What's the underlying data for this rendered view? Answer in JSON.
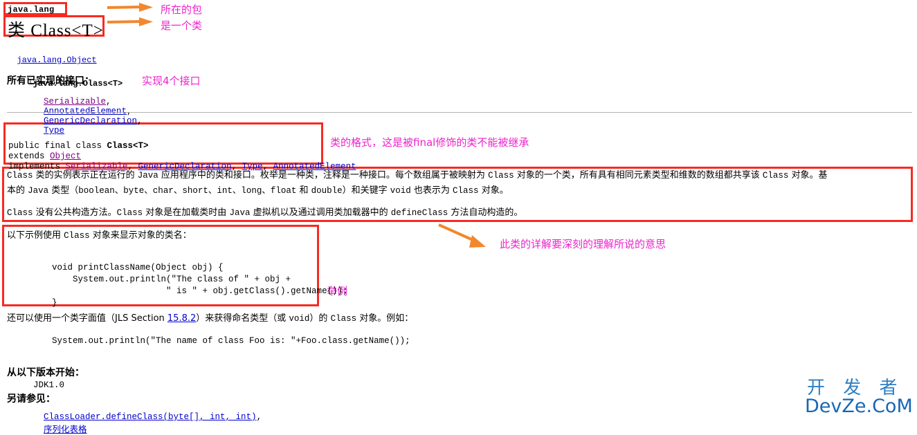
{
  "doc": {
    "package": "java.lang",
    "class_title": "类 Class<T>",
    "hierarchy": {
      "root": "java.lang.Object",
      "branch_glyph": "└",
      "child": "java.lang.Class<T>"
    },
    "interfaces_heading": "所有已实现的接口：",
    "interfaces": [
      "Serializable",
      "AnnotatedElement",
      "GenericDeclaration",
      "Type"
    ],
    "declaration": {
      "line1_prefix": "public final class ",
      "line1_class": "Class<T>",
      "line2_prefix": "extends ",
      "line2_link": "Object",
      "line3_prefix": "implements ",
      "line3_links": [
        "Serializable",
        "GenericDeclaration",
        "Type",
        "AnnotatedElement"
      ]
    },
    "description": {
      "p1_line1_a": "Class",
      "p1_line1_b": " 类的实例表示正在运行的 ",
      "p1_line1_c": "Java",
      "p1_line1_d": " 应用程序中的类和接口。枚举是一种类，注释是一种接口。每个数组属于被映射为 ",
      "p1_line1_e": "Class",
      "p1_line1_f": " 对象的一个类，所有具有相同元素类型和维数的数组都共享该 ",
      "p1_line1_g": "Class",
      "p1_line1_h": " 对象。基",
      "p1_line2_a": "本的 ",
      "p1_line2_b": "Java",
      "p1_line2_c": " 类型（",
      "p1_line2_d": "boolean、byte、char、short、int、long、float",
      "p1_line2_e": " 和 ",
      "p1_line2_f": "double",
      "p1_line2_g": "）和关键字 ",
      "p1_line2_h": "void",
      "p1_line2_i": " 也表示为 ",
      "p1_line2_j": "Class",
      "p1_line2_k": " 对象。",
      "p2_a": "Class",
      "p2_b": " 没有公共构造方法。",
      "p2_c": "Class",
      "p2_d": " 对象是在加载类时由 ",
      "p2_e": "Java",
      "p2_f": " 虚拟机以及通过调用类加载器中的 ",
      "p2_g": "defineClass",
      "p2_h": " 方法自动构造的。"
    },
    "example": {
      "intro_a": "以下示例使用 ",
      "intro_b": "Class",
      "intro_c": " 对象来显示对象的类名：",
      "code": [
        "void printClassName(Object obj) {",
        "    System.out.println(\"The class of \" + obj +",
        "                      \" is \" + obj.getClass().getName());",
        "}"
      ]
    },
    "literal": {
      "line_a": "还可以使用一个类字面值（JLS Section ",
      "line_link": "15.8.2",
      "line_b": "）来获得命名类型（或 ",
      "line_c": "void",
      "line_d": "）的 ",
      "line_e": "Class",
      "line_f": " 对象。例如：",
      "code": "System.out.println(\"The name of class Foo is: \"+Foo.class.getName());"
    },
    "since_heading": "从以下版本开始：",
    "since_value": "JDK1.0",
    "seealso_heading": "另请参见：",
    "seealso_links": [
      "ClassLoader.defineClass(byte[], int, int)",
      "序列化表格"
    ]
  },
  "annotations": {
    "note_package": "所在的包",
    "note_isclass": "是一个类",
    "note_interfaces": "实现4个接口",
    "note_format": "类的格式，这是被final修饰的类不能被继承",
    "note_detail": "此类的详解要深刻的理解所说的意思",
    "note_example": "举例"
  },
  "watermark": {
    "cn": "开 发 者",
    "en": "DevZe.CoM"
  },
  "colors": {
    "box": "#f72a21",
    "note": "#ee22cc",
    "arrow": "#f2872c",
    "link": "#0000cc",
    "link_visited": "#7d0080",
    "watermark": "#1667b4"
  }
}
